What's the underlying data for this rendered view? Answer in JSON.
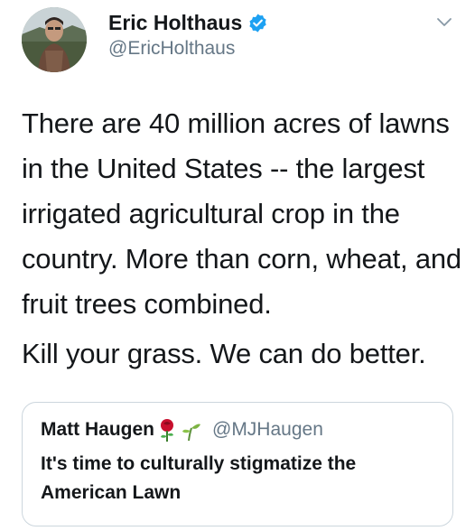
{
  "tweet": {
    "author": {
      "display_name": "Eric Holthaus",
      "handle": "@EricHolthaus",
      "verified_icon": "verified-badge-icon",
      "verified_color": "#1da1f2"
    },
    "menu_icon": "chevron-down-icon",
    "text_paragraphs": [
      "There are 40 million acres of lawns in the United States -- the largest irrigated agricultural crop in the country. More than corn, wheat, and fruit trees combined.",
      "Kill your grass. We can do better."
    ],
    "quoted_tweet": {
      "display_name": "Matt Haugen",
      "emoji_icons": [
        "rose-emoji-icon",
        "seedling-emoji-icon"
      ],
      "handle": "@MJHaugen",
      "text": "It's time to culturally stigmatize the American Lawn"
    }
  }
}
